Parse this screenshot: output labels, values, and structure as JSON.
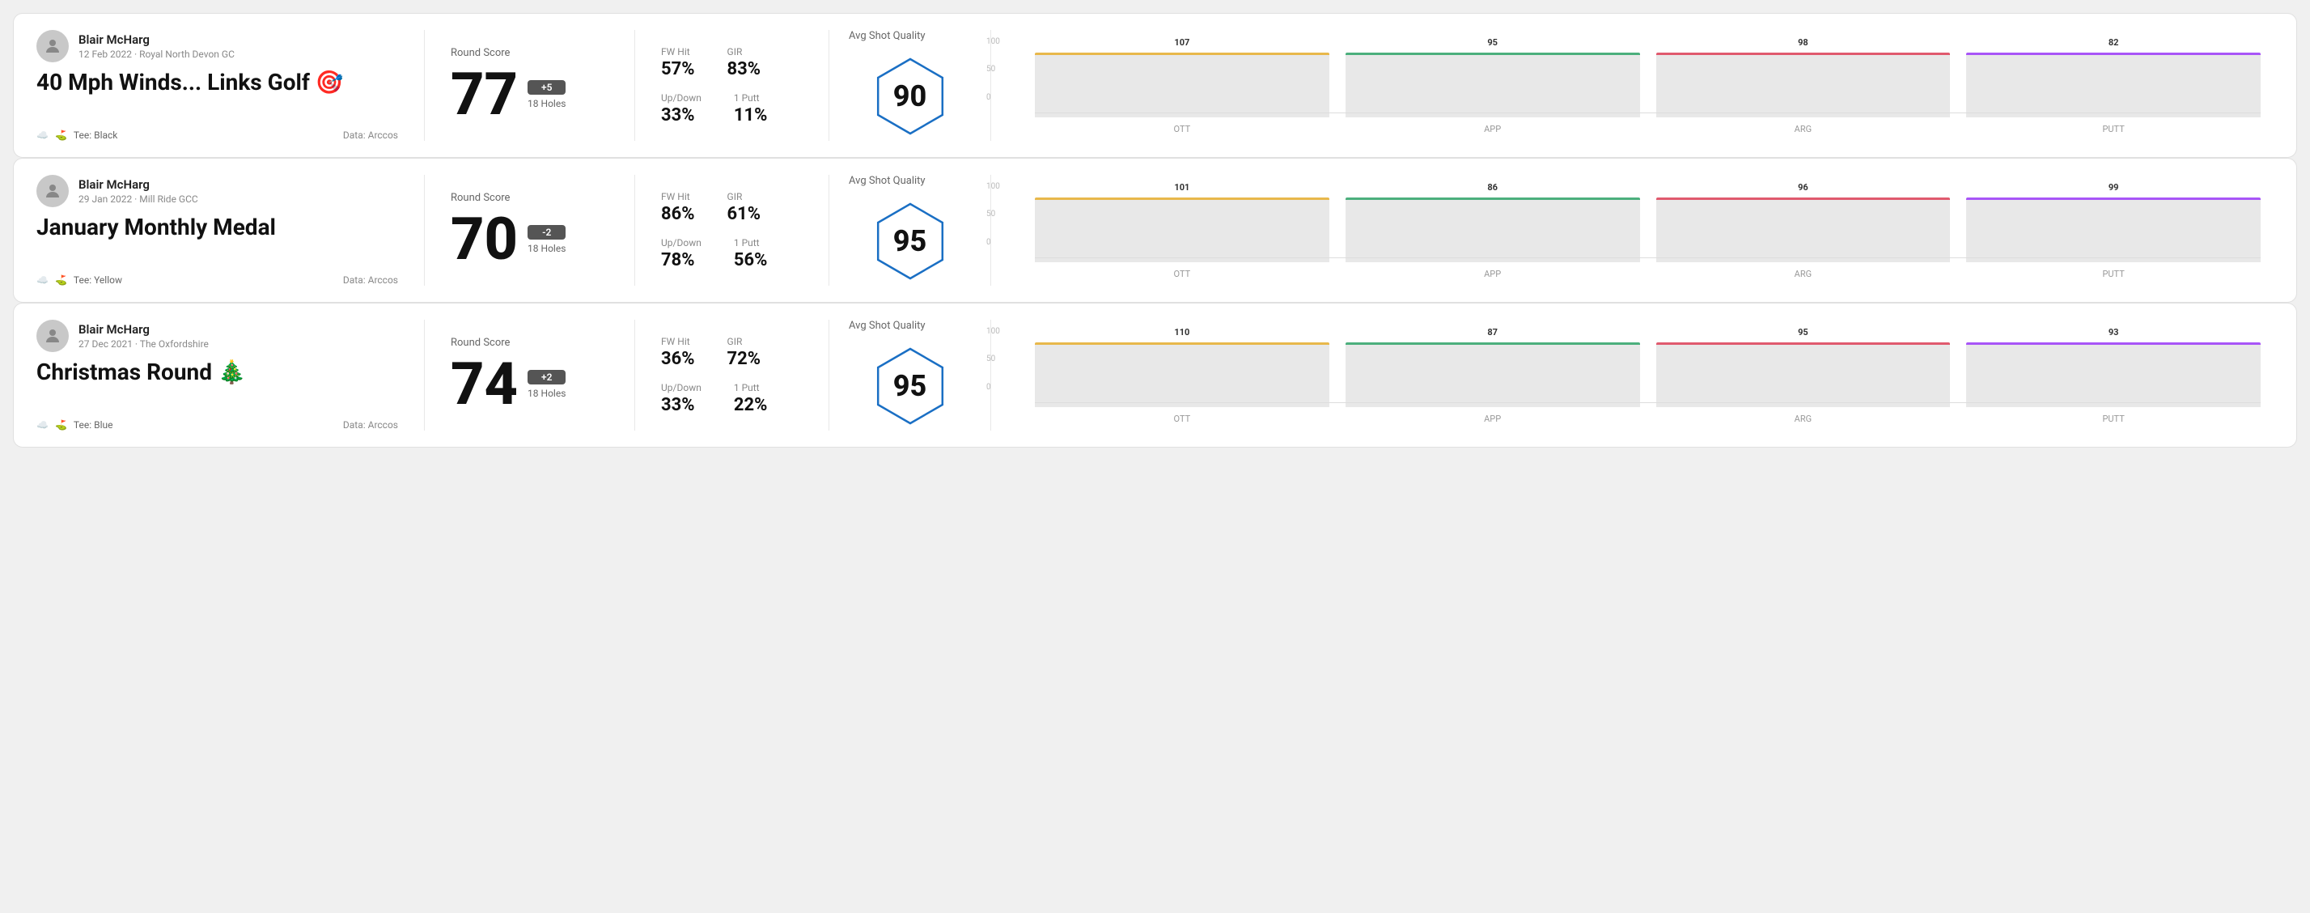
{
  "rounds": [
    {
      "id": "round1",
      "user": {
        "name": "Blair McHarg",
        "date_course": "12 Feb 2022 · Royal North Devon GC"
      },
      "title": "40 Mph Winds... Links Golf 🎯",
      "tee": "Black",
      "data_source": "Data: Arccos",
      "round_score_label": "Round Score",
      "score": "77",
      "badge": "+5",
      "holes": "18 Holes",
      "fw_hit_label": "FW Hit",
      "fw_hit_value": "57%",
      "gir_label": "GIR",
      "gir_value": "83%",
      "updown_label": "Up/Down",
      "updown_value": "33%",
      "oneputt_label": "1 Putt",
      "oneputt_value": "11%",
      "quality_label": "Avg Shot Quality",
      "quality_score": "90",
      "chart": {
        "bars": [
          {
            "label": "OTT",
            "value": 107,
            "color": "#e8b84b",
            "max": 120
          },
          {
            "label": "APP",
            "value": 95,
            "color": "#4caf7d",
            "max": 120
          },
          {
            "label": "ARG",
            "value": 98,
            "color": "#e05a6e",
            "max": 120
          },
          {
            "label": "PUTT",
            "value": 82,
            "color": "#a855f7",
            "max": 120
          }
        ],
        "y_labels": [
          "100",
          "50",
          "0"
        ]
      }
    },
    {
      "id": "round2",
      "user": {
        "name": "Blair McHarg",
        "date_course": "29 Jan 2022 · Mill Ride GCC"
      },
      "title": "January Monthly Medal",
      "tee": "Yellow",
      "data_source": "Data: Arccos",
      "round_score_label": "Round Score",
      "score": "70",
      "badge": "-2",
      "holes": "18 Holes",
      "fw_hit_label": "FW Hit",
      "fw_hit_value": "86%",
      "gir_label": "GIR",
      "gir_value": "61%",
      "updown_label": "Up/Down",
      "updown_value": "78%",
      "oneputt_label": "1 Putt",
      "oneputt_value": "56%",
      "quality_label": "Avg Shot Quality",
      "quality_score": "95",
      "chart": {
        "bars": [
          {
            "label": "OTT",
            "value": 101,
            "color": "#e8b84b",
            "max": 120
          },
          {
            "label": "APP",
            "value": 86,
            "color": "#4caf7d",
            "max": 120
          },
          {
            "label": "ARG",
            "value": 96,
            "color": "#e05a6e",
            "max": 120
          },
          {
            "label": "PUTT",
            "value": 99,
            "color": "#a855f7",
            "max": 120
          }
        ],
        "y_labels": [
          "100",
          "50",
          "0"
        ]
      }
    },
    {
      "id": "round3",
      "user": {
        "name": "Blair McHarg",
        "date_course": "27 Dec 2021 · The Oxfordshire"
      },
      "title": "Christmas Round 🎄",
      "tee": "Blue",
      "data_source": "Data: Arccos",
      "round_score_label": "Round Score",
      "score": "74",
      "badge": "+2",
      "holes": "18 Holes",
      "fw_hit_label": "FW Hit",
      "fw_hit_value": "36%",
      "gir_label": "GIR",
      "gir_value": "72%",
      "updown_label": "Up/Down",
      "updown_value": "33%",
      "oneputt_label": "1 Putt",
      "oneputt_value": "22%",
      "quality_label": "Avg Shot Quality",
      "quality_score": "95",
      "chart": {
        "bars": [
          {
            "label": "OTT",
            "value": 110,
            "color": "#e8b84b",
            "max": 120
          },
          {
            "label": "APP",
            "value": 87,
            "color": "#4caf7d",
            "max": 120
          },
          {
            "label": "ARG",
            "value": 95,
            "color": "#e05a6e",
            "max": 120
          },
          {
            "label": "PUTT",
            "value": 93,
            "color": "#a855f7",
            "max": 120
          }
        ],
        "y_labels": [
          "100",
          "50",
          "0"
        ]
      }
    }
  ]
}
